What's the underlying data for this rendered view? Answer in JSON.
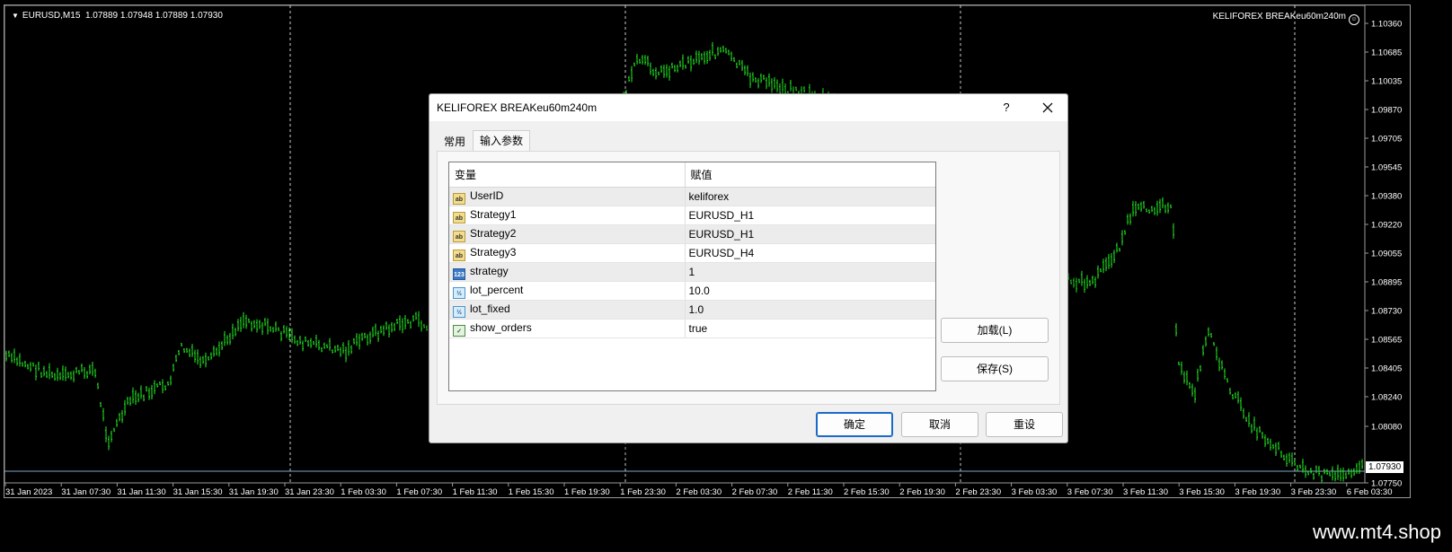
{
  "chart": {
    "header_symbol": "EURUSD,M15",
    "header_ohlc": "1.07889 1.07948 1.07889 1.07930",
    "ea_name": "KELIFOREX BREAKeu60m240m",
    "ea_smiley": "☺",
    "current_price": "1.07930",
    "price_labels": [
      "1.10360",
      "1.10685",
      "1.10035",
      "1.09870",
      "1.09705",
      "1.09545",
      "1.09380",
      "1.09220",
      "1.09055",
      "1.08895",
      "1.08730",
      "1.08565",
      "1.08405",
      "1.08240",
      "1.08080",
      "1.07750"
    ],
    "time_labels": [
      "31 Jan 2023",
      "31 Jan 07:30",
      "31 Jan 11:30",
      "31 Jan 15:30",
      "31 Jan 19:30",
      "31 Jan 23:30",
      "1 Feb 03:30",
      "1 Feb 07:30",
      "1 Feb 11:30",
      "1 Feb 15:30",
      "1 Feb 19:30",
      "1 Feb 23:30",
      "2 Feb 03:30",
      "2 Feb 07:30",
      "2 Feb 11:30",
      "2 Feb 15:30",
      "2 Feb 19:30",
      "2 Feb 23:30",
      "3 Feb 03:30",
      "3 Feb 07:30",
      "3 Feb 11:30",
      "3 Feb 15:30",
      "3 Feb 19:30",
      "3 Feb 23:30",
      "6 Feb 03:30"
    ],
    "colors": {
      "candles": "#22ee22",
      "background": "#000000",
      "separator": "#cccccc"
    }
  },
  "dialog": {
    "title": "KELIFOREX BREAKeu60m240m",
    "help_label": "?",
    "tabs": [
      {
        "label": "常用",
        "active": false
      },
      {
        "label": "输入参数",
        "active": true
      }
    ],
    "table": {
      "headers": [
        "变量",
        "赋值"
      ],
      "rows": [
        {
          "icon": "ab",
          "name": "UserID",
          "value": "keliforex"
        },
        {
          "icon": "ab",
          "name": "Strategy1",
          "value": "EURUSD_H1"
        },
        {
          "icon": "ab",
          "name": "Strategy2",
          "value": "EURUSD_H1"
        },
        {
          "icon": "ab",
          "name": "Strategy3",
          "value": "EURUSD_H4"
        },
        {
          "icon": "123",
          "name": "strategy",
          "value": "1"
        },
        {
          "icon": "1/2",
          "name": "lot_percent",
          "value": "10.0"
        },
        {
          "icon": "1/2",
          "name": "lot_fixed",
          "value": "1.0"
        },
        {
          "icon": "bool",
          "name": "show_orders",
          "value": "true"
        }
      ]
    },
    "load_label": "加载(L)",
    "save_label": "保存(S)",
    "ok_label": "确定",
    "cancel_label": "取消",
    "reset_label": "重设"
  },
  "watermark": "www.mt4.shop"
}
